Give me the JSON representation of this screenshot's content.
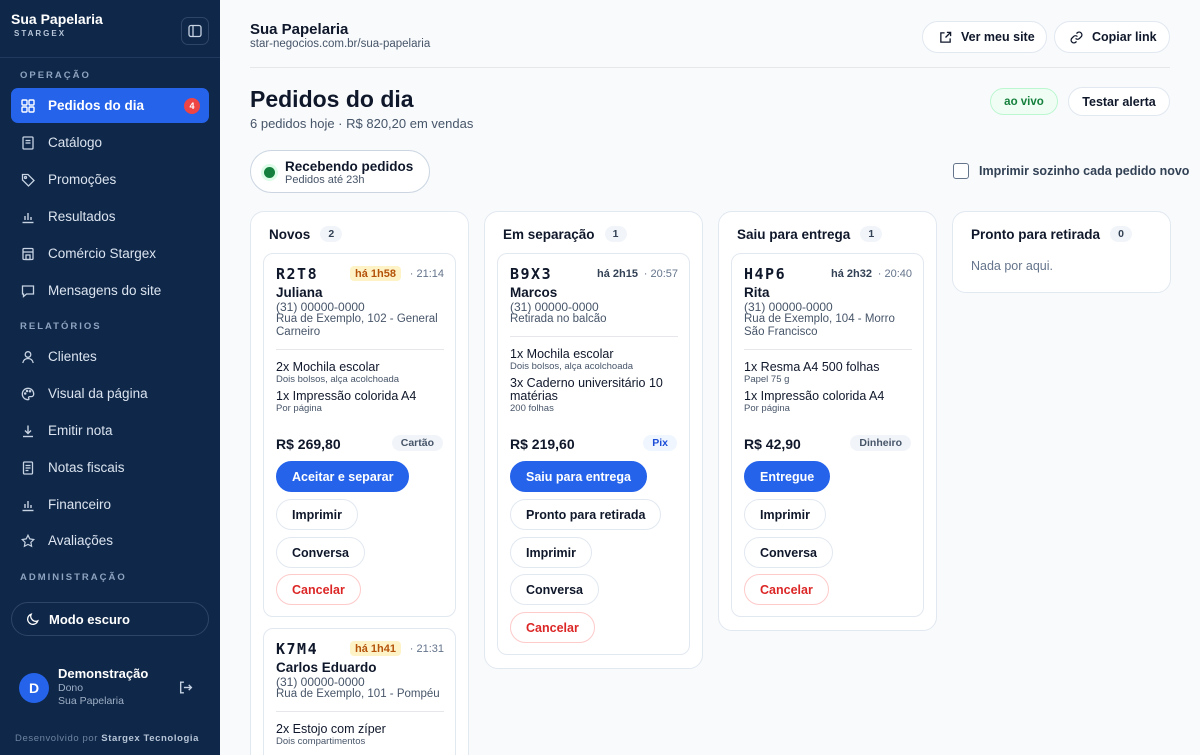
{
  "sidebar": {
    "brand": "Sua Papelaria",
    "brand_sub": "STARGEX",
    "sections": {
      "operacao": "OPERAÇÃO",
      "relatorios": "RELATÓRIOS",
      "administracao": "ADMINISTRAÇÃO"
    },
    "items": [
      {
        "label": "Pedidos do dia",
        "icon": "grid-icon",
        "badge": "4",
        "active": true
      },
      {
        "label": "Catálogo",
        "icon": "book-icon"
      },
      {
        "label": "Promoções",
        "icon": "tag-icon"
      },
      {
        "label": "Resultados",
        "icon": "bar-chart-icon"
      },
      {
        "label": "Comércio Stargex",
        "icon": "store-icon"
      },
      {
        "label": "Mensagens do site",
        "icon": "message-icon"
      },
      {
        "label": "Clientes",
        "icon": "user-icon"
      },
      {
        "label": "Visual da página",
        "icon": "palette-icon"
      },
      {
        "label": "Emitir nota",
        "icon": "download-icon"
      },
      {
        "label": "Notas fiscais",
        "icon": "receipt-icon"
      },
      {
        "label": "Financeiro",
        "icon": "bar-chart-icon"
      },
      {
        "label": "Avaliações",
        "icon": "star-icon"
      }
    ],
    "dark_mode_label": "Modo escuro",
    "user": {
      "initial": "D",
      "name": "Demonstração",
      "role": "Dono",
      "store": "Sua Papelaria"
    },
    "credit_prefix": "Desenvolvido por",
    "credit_company": "Stargex Tecnologia"
  },
  "header": {
    "store_title": "Sua Papelaria",
    "store_url": "star-negocios.com.br/sua-papelaria",
    "view_site": "Ver meu site",
    "copy_link": "Copiar link"
  },
  "page": {
    "title": "Pedidos do dia",
    "subtitle": "6 pedidos hoje · R$ 820,20 em vendas",
    "live": "ao vivo",
    "test_alert": "Testar alerta",
    "status_title": "Recebendo pedidos",
    "status_sub": "Pedidos até 23h",
    "auto_print": "Imprimir sozinho cada pedido novo"
  },
  "columns": [
    {
      "title": "Novos",
      "count": "2"
    },
    {
      "title": "Em separação",
      "count": "1"
    },
    {
      "title": "Saiu para entrega",
      "count": "1"
    },
    {
      "title": "Pronto para retirada",
      "count": "0",
      "empty": "Nada por aqui."
    }
  ],
  "orders": {
    "r2t8": {
      "code": "R2T8",
      "elapsed": "há 1h58",
      "time": "· 21:14",
      "name": "Juliana",
      "phone": "(31) 00000-0000",
      "address": "Rua de Exemplo, 102 - General Carneiro",
      "items": [
        {
          "name": "2x Mochila escolar",
          "desc": "Dois bolsos, alça acolchoada"
        },
        {
          "name": "1x Impressão colorida A4",
          "desc": "Por página"
        }
      ],
      "total": "R$ 269,80",
      "payment": "Cartão",
      "actions": [
        "Aceitar e separar",
        "Imprimir",
        "Conversa",
        "Cancelar"
      ]
    },
    "k7m4": {
      "code": "K7M4",
      "elapsed": "há 1h41",
      "time": "· 21:31",
      "name": "Carlos Eduardo",
      "phone": "(31) 00000-0000",
      "address": "Rua de Exemplo, 101 - Pompéu",
      "items": [
        {
          "name": "2x Estojo com zíper",
          "desc": "Dois compartimentos"
        }
      ]
    },
    "b9x3": {
      "code": "B9X3",
      "elapsed": "há 2h15",
      "time": "· 20:57",
      "name": "Marcos",
      "phone": "(31) 00000-0000",
      "address": "Retirada no balcão",
      "items": [
        {
          "name": "1x Mochila escolar",
          "desc": "Dois bolsos, alça acolchoada"
        },
        {
          "name": "3x Caderno universitário 10 matérias",
          "desc": "200 folhas"
        }
      ],
      "total": "R$ 219,60",
      "payment": "Pix",
      "actions": [
        "Saiu para entrega",
        "Pronto para retirada",
        "Imprimir",
        "Conversa",
        "Cancelar"
      ]
    },
    "h4p6": {
      "code": "H4P6",
      "elapsed": "há 2h32",
      "time": "· 20:40",
      "name": "Rita",
      "phone": "(31) 00000-0000",
      "address": "Rua de Exemplo, 104 - Morro São Francisco",
      "items": [
        {
          "name": "1x Resma A4 500 folhas",
          "desc": "Papel 75 g"
        },
        {
          "name": "1x Impressão colorida A4",
          "desc": "Por página"
        }
      ],
      "total": "R$ 42,90",
      "payment": "Dinheiro",
      "actions": [
        "Entregue",
        "Imprimir",
        "Conversa",
        "Cancelar"
      ]
    }
  },
  "colors": {
    "sidebar": "#0f2748",
    "accent": "#2563eb",
    "live": "#15803d",
    "danger": "#dc2626",
    "warn": "#b45309"
  }
}
